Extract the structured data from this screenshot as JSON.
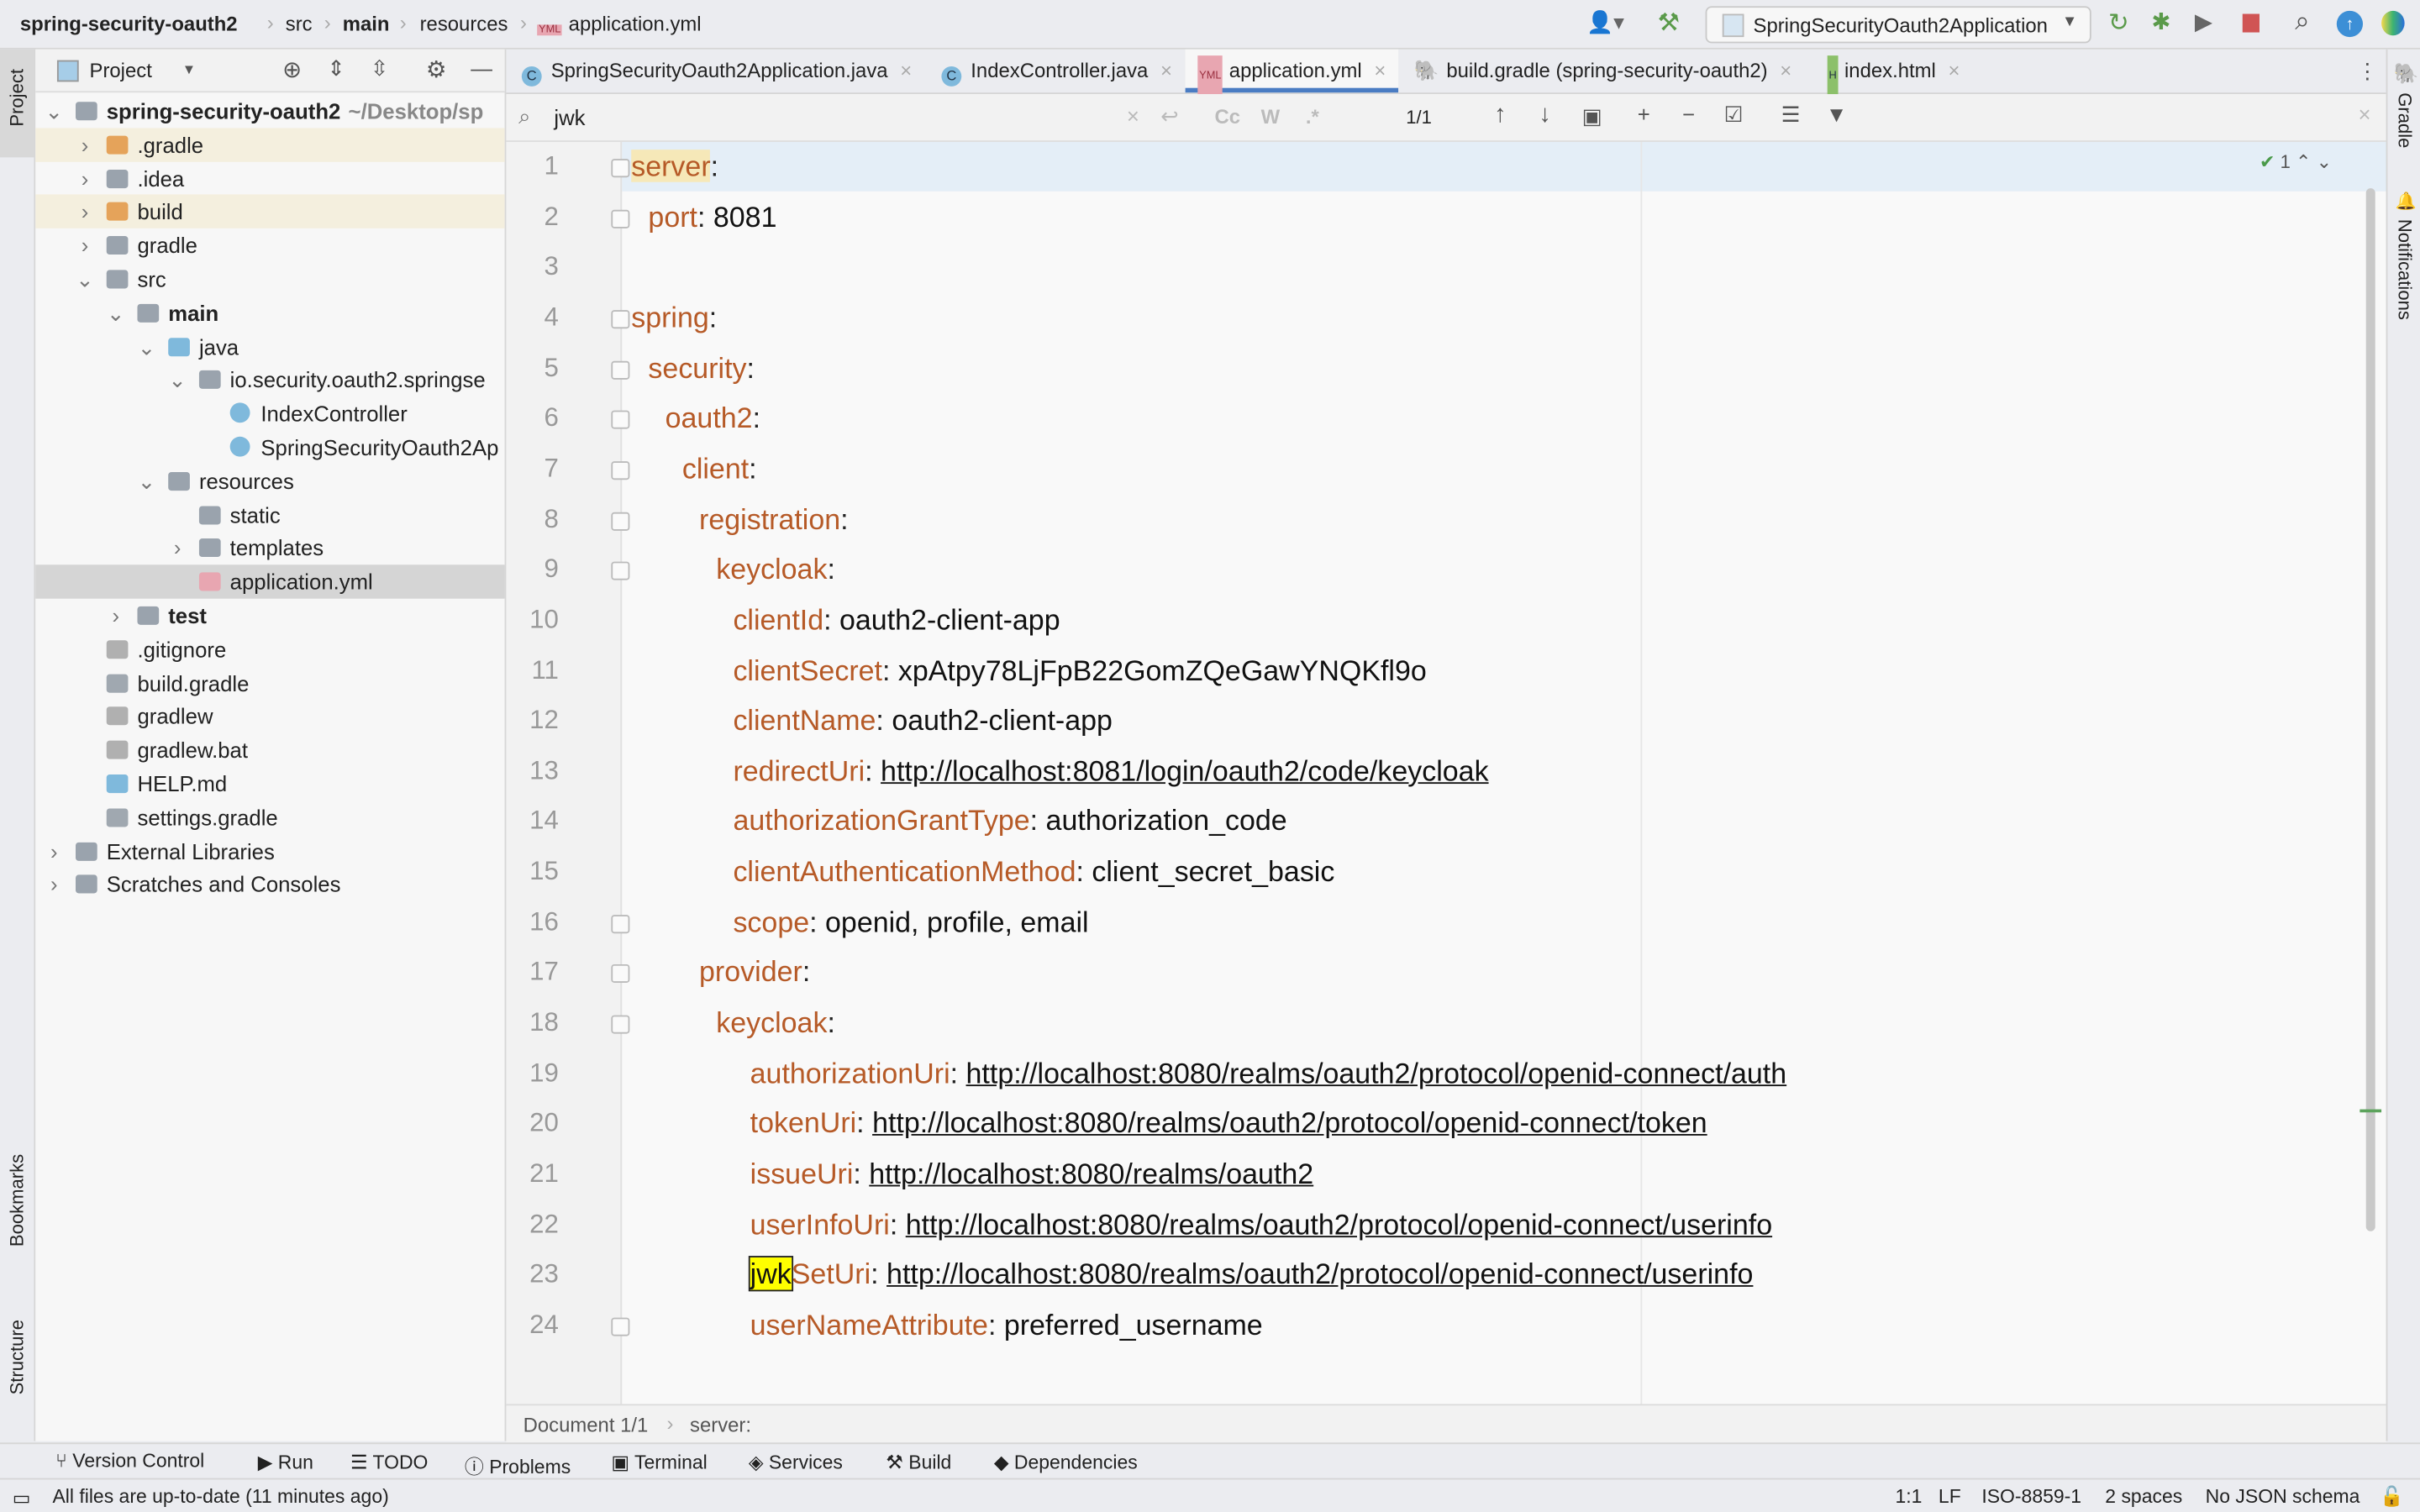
{
  "breadcrumb": [
    "spring-security-oauth2",
    "src",
    "main",
    "resources",
    "application.yml"
  ],
  "run_config": "SpringSecurityOauth2Application",
  "project_panel": {
    "title": "Project"
  },
  "tree": [
    {
      "label": "spring-security-oauth2",
      "hint": "~/Desktop/sp",
      "level": 0,
      "arrow": "down",
      "icon": "module",
      "bold": true
    },
    {
      "label": ".gradle",
      "level": 1,
      "arrow": "right",
      "icon": "folder-orange",
      "hl": true
    },
    {
      "label": ".idea",
      "level": 1,
      "arrow": "right",
      "icon": "folder"
    },
    {
      "label": "build",
      "level": 1,
      "arrow": "right",
      "icon": "folder-orange",
      "hl": true
    },
    {
      "label": "gradle",
      "level": 1,
      "arrow": "right",
      "icon": "folder"
    },
    {
      "label": "src",
      "level": 1,
      "arrow": "down",
      "icon": "folder"
    },
    {
      "label": "main",
      "level": 2,
      "arrow": "down",
      "icon": "folder",
      "bold": true
    },
    {
      "label": "java",
      "level": 3,
      "arrow": "down",
      "icon": "folder-blue"
    },
    {
      "label": "io.security.oauth2.springse",
      "level": 4,
      "arrow": "down",
      "icon": "package"
    },
    {
      "label": "IndexController",
      "level": 5,
      "icon": "class"
    },
    {
      "label": "SpringSecurityOauth2Ap",
      "level": 5,
      "icon": "class"
    },
    {
      "label": "resources",
      "level": 3,
      "arrow": "down",
      "icon": "folder-res"
    },
    {
      "label": "static",
      "level": 4,
      "icon": "folder"
    },
    {
      "label": "templates",
      "level": 4,
      "arrow": "right",
      "icon": "folder"
    },
    {
      "label": "application.yml",
      "level": 4,
      "icon": "yml",
      "selected": true
    },
    {
      "label": "test",
      "level": 2,
      "arrow": "right",
      "icon": "folder",
      "bold": true
    },
    {
      "label": ".gitignore",
      "level": 1,
      "icon": "file"
    },
    {
      "label": "build.gradle",
      "level": 1,
      "icon": "gradle"
    },
    {
      "label": "gradlew",
      "level": 1,
      "icon": "file"
    },
    {
      "label": "gradlew.bat",
      "level": 1,
      "icon": "file"
    },
    {
      "label": "HELP.md",
      "level": 1,
      "icon": "md"
    },
    {
      "label": "settings.gradle",
      "level": 1,
      "icon": "gradle"
    },
    {
      "label": "External Libraries",
      "level": 0,
      "arrow": "right",
      "icon": "lib"
    },
    {
      "label": "Scratches and Consoles",
      "level": 0,
      "arrow": "right",
      "icon": "scratch"
    }
  ],
  "tabs": [
    {
      "label": "SpringSecurityOauth2Application.java",
      "icon": "class"
    },
    {
      "label": "IndexController.java",
      "icon": "class"
    },
    {
      "label": "application.yml",
      "icon": "yml",
      "active": true
    },
    {
      "label": "build.gradle (spring-security-oauth2)",
      "icon": "gradle"
    },
    {
      "label": "index.html",
      "icon": "html"
    }
  ],
  "search": {
    "query": "jwk",
    "count": "1/1",
    "match_case": "Cc",
    "words": "W",
    "regex": ".*"
  },
  "inspection": {
    "count": "1"
  },
  "code": [
    {
      "n": "1",
      "indent": 0,
      "key": "server",
      "val": "",
      "fold": true
    },
    {
      "n": "2",
      "indent": 1,
      "key": "port",
      "val": "8081",
      "fold": true
    },
    {
      "n": "3",
      "indent": 0,
      "key": "",
      "val": ""
    },
    {
      "n": "4",
      "indent": 0,
      "key": "spring",
      "val": "",
      "fold": true
    },
    {
      "n": "5",
      "indent": 1,
      "key": "security",
      "val": "",
      "fold": true
    },
    {
      "n": "6",
      "indent": 2,
      "key": "oauth2",
      "val": "",
      "fold": true
    },
    {
      "n": "7",
      "indent": 3,
      "key": "client",
      "val": "",
      "fold": true
    },
    {
      "n": "8",
      "indent": 4,
      "key": "registration",
      "val": "",
      "fold": true
    },
    {
      "n": "9",
      "indent": 5,
      "key": "keycloak",
      "val": "",
      "fold": true
    },
    {
      "n": "10",
      "indent": 6,
      "key": "clientId",
      "val": "oauth2-client-app"
    },
    {
      "n": "11",
      "indent": 6,
      "key": "clientSecret",
      "val": "xpAtpy78LjFpB22GomZQeGawYNQKfl9o"
    },
    {
      "n": "12",
      "indent": 6,
      "key": "clientName",
      "val": "oauth2-client-app"
    },
    {
      "n": "13",
      "indent": 6,
      "key": "redirectUri",
      "val": "http://localhost:8081/login/oauth2/code/keycloak",
      "url": true
    },
    {
      "n": "14",
      "indent": 6,
      "key": "authorizationGrantType",
      "val": "authorization_code"
    },
    {
      "n": "15",
      "indent": 6,
      "key": "clientAuthenticationMethod",
      "val": "client_secret_basic"
    },
    {
      "n": "16",
      "indent": 6,
      "key": "scope",
      "val": "openid, profile, email",
      "fold": true
    },
    {
      "n": "17",
      "indent": 4,
      "key": "provider",
      "val": "",
      "fold": true
    },
    {
      "n": "18",
      "indent": 5,
      "key": "keycloak",
      "val": "",
      "fold": true
    },
    {
      "n": "19",
      "indent": 7,
      "key": "authorizationUri",
      "val": "http://localhost:8080/realms/oauth2/protocol/openid-connect/auth",
      "url": true
    },
    {
      "n": "20",
      "indent": 7,
      "key": "tokenUri",
      "val": "http://localhost:8080/realms/oauth2/protocol/openid-connect/token",
      "url": true
    },
    {
      "n": "21",
      "indent": 7,
      "key": "issueUri",
      "val": "http://localhost:8080/realms/oauth2",
      "url": true
    },
    {
      "n": "22",
      "indent": 7,
      "key": "userInfoUri",
      "val": "http://localhost:8080/realms/oauth2/protocol/openid-connect/userinfo",
      "url": true
    },
    {
      "n": "23",
      "indent": 7,
      "key": "jwkSetUri",
      "match": "jwk",
      "val": "http://localhost:8080/realms/oauth2/protocol/openid-connect/userinfo",
      "url": true
    },
    {
      "n": "24",
      "indent": 7,
      "key": "userNameAttribute",
      "val": "preferred_username",
      "fold": true
    }
  ],
  "editor_breadcrumb": [
    "Document 1/1",
    "server:"
  ],
  "left_strip": [
    "Project",
    "Bookmarks",
    "Structure"
  ],
  "right_strip": [
    "Gradle",
    "Notifications"
  ],
  "tool_windows": [
    "Version Control",
    "Run",
    "TODO",
    "Problems",
    "Terminal",
    "Services",
    "Build",
    "Dependencies"
  ],
  "status": {
    "message": "All files are up-to-date (11 minutes ago)",
    "position": "1:1",
    "line_sep": "LF",
    "encoding": "ISO-8859-1",
    "indent": "2 spaces",
    "schema": "No JSON schema"
  },
  "colors": {
    "key": "#b65a27",
    "accent": "#4a7cc3",
    "search_match": "#ffff00"
  }
}
